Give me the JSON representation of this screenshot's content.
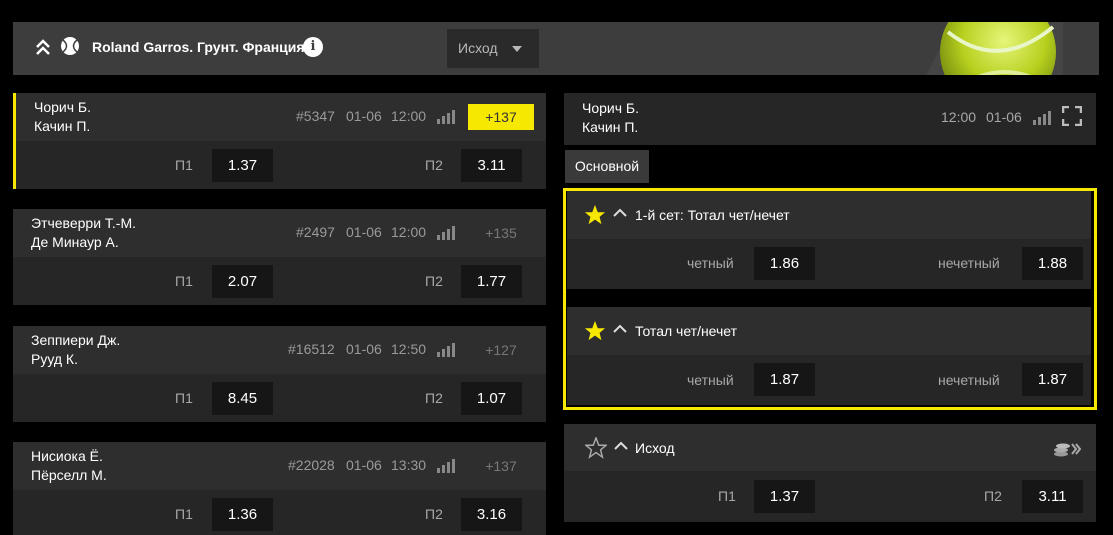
{
  "header": {
    "tournament": "Roland Garros. Грунт. Франция",
    "info_glyph": "i",
    "select_value": "Исход"
  },
  "matches": [
    {
      "team1": "Чорич Б.",
      "team2": "Качин П.",
      "id": "#5347",
      "date": "01-06",
      "time": "12:00",
      "more": "+137",
      "p1_label": "П1",
      "p1": "1.37",
      "p2_label": "П2",
      "p2": "3.11"
    },
    {
      "team1": "Этчеверри Т.-М.",
      "team2": "Де Минаур А.",
      "id": "#2497",
      "date": "01-06",
      "time": "12:00",
      "more": "+135",
      "p1_label": "П1",
      "p1": "2.07",
      "p2_label": "П2",
      "p2": "1.77"
    },
    {
      "team1": "Зеппиери Дж.",
      "team2": "Рууд К.",
      "id": "#16512",
      "date": "01-06",
      "time": "12:50",
      "more": "+127",
      "p1_label": "П1",
      "p1": "8.45",
      "p2_label": "П2",
      "p2": "1.07"
    },
    {
      "team1": "Нисиока Ё.",
      "team2": "Пёрселл М.",
      "id": "#22028",
      "date": "01-06",
      "time": "13:30",
      "more": "+137",
      "p1_label": "П1",
      "p1": "1.36",
      "p2_label": "П2",
      "p2": "3.16"
    }
  ],
  "detail": {
    "team1": "Чорич Б.",
    "team2": "Качин П.",
    "time": "12:00",
    "date": "01-06",
    "tab": "Основной"
  },
  "markets": [
    {
      "title": "1-й сет: Тотал чет/нечет",
      "even_label": "четный",
      "even": "1.86",
      "odd_label": "нечетный",
      "odd": "1.88",
      "starred": true
    },
    {
      "title": "Тотал чет/нечет",
      "even_label": "четный",
      "even": "1.87",
      "odd_label": "нечетный",
      "odd": "1.87",
      "starred": true
    },
    {
      "title": "Исход",
      "p1_label": "П1",
      "p1": "1.37",
      "p2_label": "П2",
      "p2": "3.11",
      "starred": false
    }
  ],
  "colors": {
    "accent": "#f6e800",
    "panel": "#262626",
    "header": "#3d3d3d"
  }
}
